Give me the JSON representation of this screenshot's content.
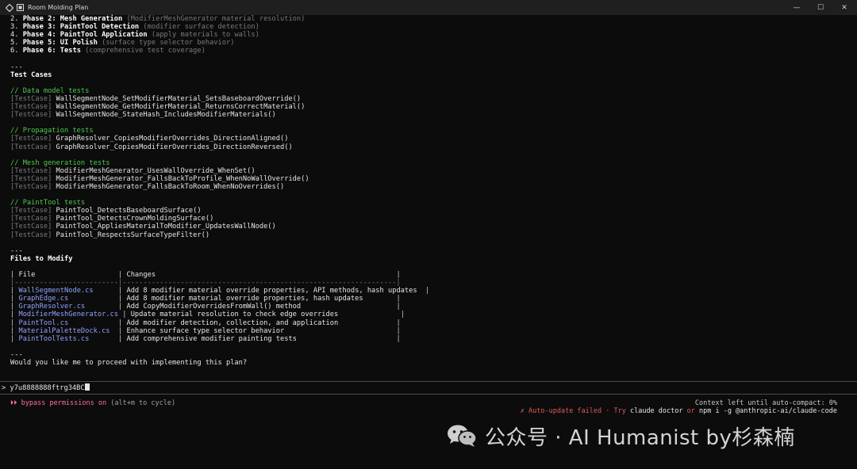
{
  "window": {
    "title": "Room Molding Plan",
    "controls": {
      "minimize": "—",
      "maximize": "☐",
      "close": "✕"
    }
  },
  "phases": [
    {
      "num": "2.",
      "label": "Phase 2: Mesh Generation",
      "desc": "(ModifierMeshGenerator material resolution)"
    },
    {
      "num": "3.",
      "label": "Phase 3: PaintTool Detection",
      "desc": "(modifier surface detection)"
    },
    {
      "num": "4.",
      "label": "Phase 4: PaintTool Application",
      "desc": "(apply materials to walls)"
    },
    {
      "num": "5.",
      "label": "Phase 5: UI Polish",
      "desc": "(surface type selector behavior)"
    },
    {
      "num": "6.",
      "label": "Phase 6: Tests",
      "desc": "(comprehensive test coverage)"
    }
  ],
  "separator": "---",
  "test_cases": {
    "heading": "Test Cases",
    "tag": "[TestCase]",
    "groups": [
      {
        "comment": "// Data model tests",
        "items": [
          "WallSegmentNode_SetModifierMaterial_SetsBaseboardOverride()",
          "WallSegmentNode_GetModifierMaterial_ReturnsCorrectMaterial()",
          "WallSegmentNode_StateHash_IncludesModifierMaterials()"
        ]
      },
      {
        "comment": "// Propagation tests",
        "items": [
          "GraphResolver_CopiesModifierOverrides_DirectionAligned()",
          "GraphResolver_CopiesModifierOverrides_DirectionReversed()"
        ]
      },
      {
        "comment": "// Mesh generation tests",
        "items": [
          "ModifierMeshGenerator_UsesWallOverride_WhenSet()",
          "ModifierMeshGenerator_FallsBackToProfile_WhenNoWallOverride()",
          "ModifierMeshGenerator_FallsBackToRoom_WhenNoOverrides()"
        ]
      },
      {
        "comment": "// PaintTool tests",
        "items": [
          "PaintTool_DetectsBaseboardSurface()",
          "PaintTool_DetectsCrownMoldingSurface()",
          "PaintTool_AppliesMaterialToModifier_UpdatesWallNode()",
          "PaintTool_RespectsSurfaceTypeFilter()"
        ]
      }
    ]
  },
  "files": {
    "heading": "Files to Modify",
    "col_file": "File",
    "col_changes": "Changes",
    "rule": "|-------------------------|------------------------------------------------------------------|",
    "rows": [
      {
        "file": "WallSegmentNode.cs",
        "change": "Add 8 modifier material override properties, API methods, hash updates",
        "pad_file": 24,
        "pad_change": 64
      },
      {
        "file": "GraphEdge.cs",
        "change": "Add 8 modifier material override properties, hash updates"
      },
      {
        "file": "GraphResolver.cs",
        "change": "Add CopyModifierOverridesFromWall() method"
      },
      {
        "file": "ModifierMeshGenerator.cs",
        "change": "Update material resolution to check edge overrides"
      },
      {
        "file": "PaintTool.cs",
        "change": "Add modifier detection, collection, and application"
      },
      {
        "file": "MaterialPaletteDock.cs",
        "change": "Enhance surface type selector behavior"
      },
      {
        "file": "PaintToolTests.cs",
        "change": "Add comprehensive modifier painting tests"
      }
    ]
  },
  "question": "Would you like me to proceed with implementing this plan?",
  "input": {
    "prompt": ">",
    "value": "y7u8888888ftrg34BC"
  },
  "status": {
    "bypass_marker": "⏵⏵",
    "bypass_label": "bypass permissions on",
    "bypass_hint": "(alt+m to cycle)",
    "context": "Context left until auto-compact: 0%",
    "update_mark": "✗",
    "update_text": "Auto-update failed · Try",
    "update_cmd1": "claude doctor",
    "update_or": "or",
    "update_cmd2": "npm i -g @anthropic-ai/claude-code"
  },
  "watermark": {
    "text": "公众号 · AI Humanist by杉森楠"
  },
  "colors": {
    "background": "#0c0c0c",
    "comment": "#4ec94e",
    "file_link": "#8fa3ff",
    "bypass": "#ff6f93",
    "error": "#e05a5a"
  }
}
